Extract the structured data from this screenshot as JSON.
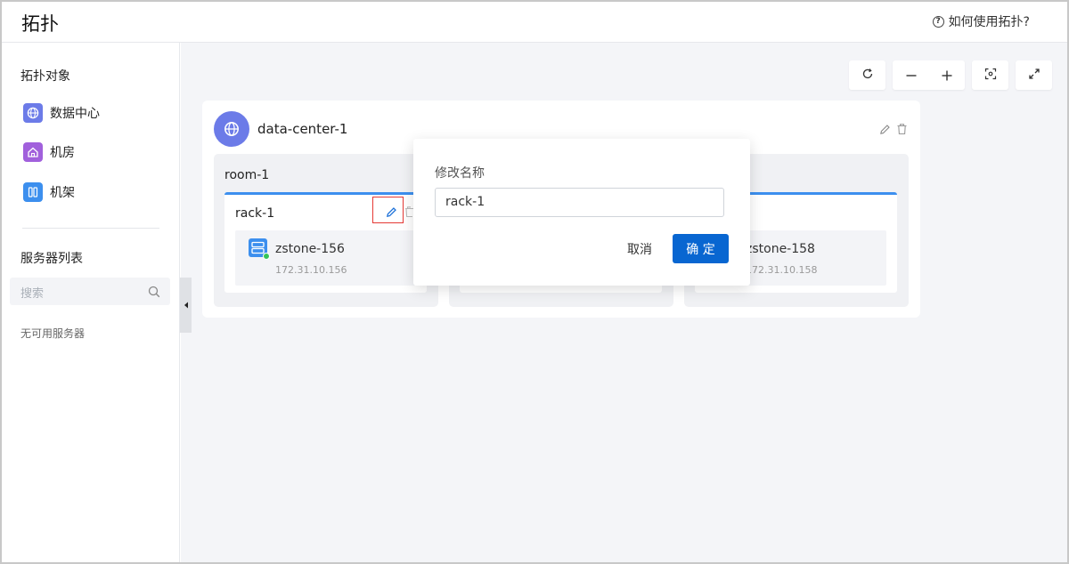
{
  "header": {
    "title": "拓扑",
    "help_label": "如何使用拓扑?"
  },
  "sidebar": {
    "objects_title": "拓扑对象",
    "objects": [
      {
        "label": "数据中心",
        "icon": "globe-icon",
        "color": "#6c7be8"
      },
      {
        "label": "机房",
        "icon": "house-icon",
        "color": "#a160dc"
      },
      {
        "label": "机架",
        "icon": "rack-icon",
        "color": "#3c8fee"
      }
    ],
    "servers_title": "服务器列表",
    "search_placeholder": "搜索",
    "empty_text": "无可用服务器"
  },
  "toolbar": {
    "refresh_icon": "refresh-icon",
    "zoom_out_icon": "minus-icon",
    "zoom_in_icon": "plus-icon",
    "fit_icon": "fit-screen-icon",
    "fullscreen_icon": "expand-icon"
  },
  "topology": {
    "datacenter_name": "data-center-1",
    "rooms": [
      {
        "name": "room-1",
        "rack": "rack-1",
        "server_name": "zstone-156",
        "server_ip": "172.31.10.156"
      },
      {
        "name": "",
        "rack": "",
        "server_name": "",
        "server_ip": ""
      },
      {
        "name": "",
        "rack": "",
        "server_name": "zstone-158",
        "server_ip": "172.31.10.158"
      }
    ]
  },
  "dialog": {
    "title": "修改名称",
    "input_value": "rack-1",
    "cancel_label": "取消",
    "ok_label": "确 定"
  },
  "colors": {
    "primary": "#0866d1",
    "accent": "#3c8fee",
    "online": "#35c45a"
  }
}
